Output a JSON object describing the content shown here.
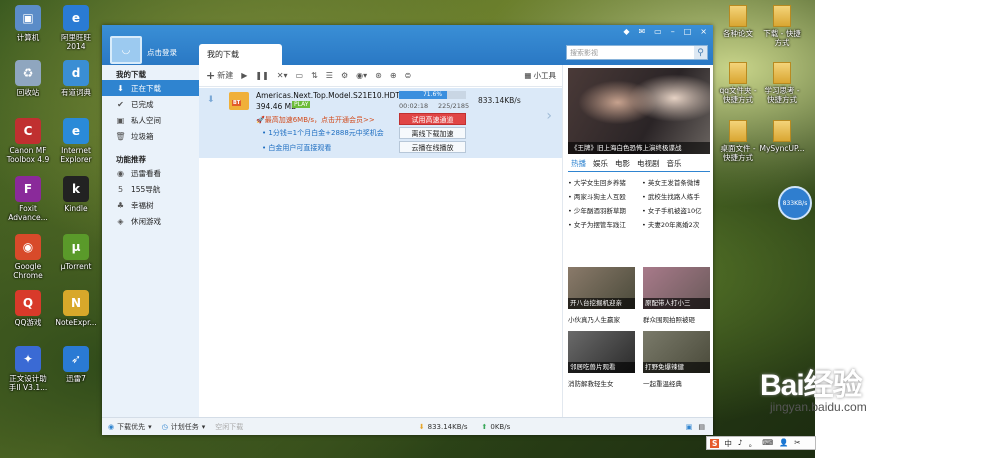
{
  "desktop_left": [
    {
      "label": "计算机",
      "color": "#5b8cc8",
      "glyph": "▣"
    },
    {
      "label": "阿里旺旺\n2014",
      "color": "#2a7bd4",
      "glyph": "e"
    },
    {
      "label": "回收站",
      "color": "#8fa6bf",
      "glyph": "♻"
    },
    {
      "label": "有道词典",
      "color": "#3a8ed4",
      "glyph": "d"
    },
    {
      "label": "Canon MF\nToolbox 4.9",
      "color": "#c03030",
      "glyph": "C"
    },
    {
      "label": "Internet\nExplorer",
      "color": "#2a8ad8",
      "glyph": "e"
    },
    {
      "label": "Foxit\nAdvance...",
      "color": "#8a2a9a",
      "glyph": "F"
    },
    {
      "label": "Kindle",
      "color": "#222222",
      "glyph": "k"
    },
    {
      "label": "Google\nChrome",
      "color": "#d84a2a",
      "glyph": "◉"
    },
    {
      "label": "µTorrent",
      "color": "#5a9a2a",
      "glyph": "μ"
    },
    {
      "label": "QQ游戏",
      "color": "#d83a2a",
      "glyph": "Q"
    },
    {
      "label": "NoteExpr...",
      "color": "#d8a82a",
      "glyph": "N"
    },
    {
      "label": "正文设计助\n手II V3.1...",
      "color": "#3a6ad4",
      "glyph": "✦"
    },
    {
      "label": "迅雷7",
      "color": "#2a7ad4",
      "glyph": "➶"
    }
  ],
  "desktop_right": [
    {
      "label": "各种论文"
    },
    {
      "label": "下载 - 快捷\n方式"
    },
    {
      "label": "qq文件夹 -\n快捷方式"
    },
    {
      "label": "学习思考 -\n快捷方式"
    },
    {
      "label": "桌面文件 -\n快捷方式"
    },
    {
      "label": "MySyncUP..."
    }
  ],
  "badge": "833KB/s",
  "window": {
    "login": "点击登录",
    "tab": "我的下载",
    "search_placeholder": "搜索影视",
    "controls": [
      "◆",
      "✉",
      "▭",
      "–",
      "□",
      "×"
    ]
  },
  "sidebar": {
    "head1": "我的下载",
    "items1": [
      {
        "label": "正在下载",
        "icon": "⬇",
        "active": true
      },
      {
        "label": "已完成",
        "icon": "✔"
      },
      {
        "label": "私人空间",
        "icon": "▣"
      },
      {
        "label": "垃圾箱",
        "icon": "🗑"
      }
    ],
    "head2": "功能推荐",
    "items2": [
      {
        "label": "迅雷看看",
        "icon": "◉"
      },
      {
        "label": "155导航",
        "icon": "5"
      },
      {
        "label": "幸福树",
        "icon": "♣"
      },
      {
        "label": "休闲游戏",
        "icon": "◈"
      }
    ]
  },
  "toolbar": {
    "new": "新建",
    "tools": "小工具"
  },
  "task": {
    "name": "Americas.Next.Top.Model.S21E10.HDTV...",
    "size": "394.46 MB",
    "play": "PLAY",
    "accelerate": "最高加速6MB/s，点击开通会员>>",
    "ad1": "1分钱=1个月白金+2888元中奖机会",
    "ad2": "白金用户可直接观看",
    "progress_text": "71.6%",
    "progress": 71.6,
    "elapsed": "00:02:18",
    "counts": "225/2185",
    "speed": "833.14KB/s",
    "btn_trial": "试用高速通道",
    "btn_offline": "离线下载加速",
    "btn_cloud": "云播在线播放"
  },
  "right": {
    "poster_caption": "《王牌》旧上海白色恐怖上演终极谍战",
    "tabs": [
      "热播",
      "娱乐",
      "电影",
      "电视剧",
      "音乐"
    ],
    "news": [
      "大学女生回乡养猪",
      "英女王发首条微博",
      "两家斗狗主人互殴",
      "武校生找路人练手",
      "少年酗酒羽断草期",
      "女子手机被盗10亿",
      "女子为摆管车践江",
      "夫妻20年离婚2次"
    ],
    "thumbs": [
      {
        "caption": "开八台挖掘机迎亲",
        "sub": "小伙真乃人生赢家"
      },
      {
        "caption": "原配带人打小三",
        "sub": "群众围观拍照被砸"
      },
      {
        "caption": "邻居吃兽片观看",
        "sub": "消防解救轻生女"
      },
      {
        "caption": "打野免爆辣健",
        "sub": "一起重温经典"
      }
    ]
  },
  "status": {
    "priority": "下载优先",
    "plan": "计划任务",
    "idle": "空闲下载",
    "down_speed": "833.14KB/s",
    "up_speed": "0KB/s"
  },
  "ime": {
    "s": "S",
    "items": [
      "中",
      "♪",
      "。",
      "⌨",
      "👤",
      "✂"
    ]
  },
  "watermark": {
    "brand": "Bai经验",
    "url": "jingyan.baidu.com"
  }
}
